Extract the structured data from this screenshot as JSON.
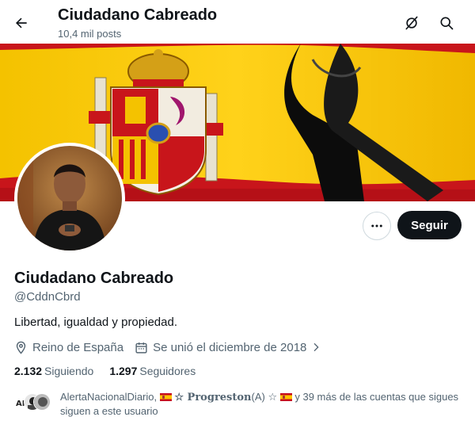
{
  "header": {
    "title": "Ciudadano Cabreado",
    "posts_count": "10,4 mil posts",
    "back_icon": "arrow-left-icon",
    "icons": [
      "grok-icon",
      "search-icon"
    ]
  },
  "profile": {
    "name": "Ciudadano Cabreado",
    "handle": "@CddnCbrd",
    "bio": "Libertad, igualdad y propiedad.",
    "location": "Reino de España",
    "joined": "Se unió el diciembre de 2018",
    "following_count": "2.132",
    "following_label": "Siguiendo",
    "followers_count": "1.297",
    "followers_label": "Seguidores"
  },
  "actions": {
    "more_label": "•••",
    "follow_label": "Seguir"
  },
  "followed_by": {
    "name1": "AlertaNacionalDiario,",
    "name2": "☆ Progreston",
    "name2_suffix": "(A) ☆",
    "rest": "y 39 más de las cuentas que sigues",
    "line2": "siguen a este usuario"
  },
  "colors": {
    "text": "#0f1419",
    "muted": "#536471",
    "border": "#cfd9de",
    "button_dark": "#0f1419",
    "flag_red": "#c60b1e",
    "flag_yellow": "#f2c200"
  }
}
